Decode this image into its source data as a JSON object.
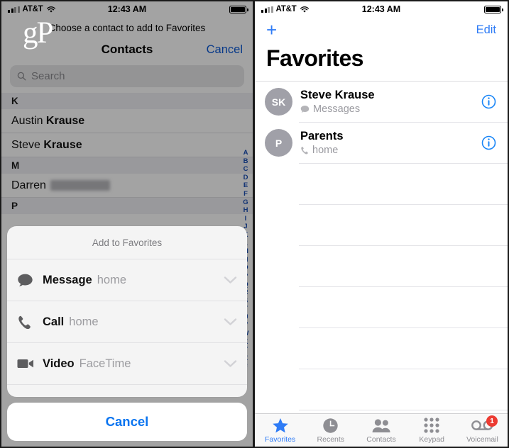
{
  "status_bar": {
    "carrier": "AT&T",
    "time": "12:43 AM",
    "signal_bars_filled": 2,
    "signal_bars_total": 4,
    "wifi": "wifi-icon",
    "battery": "battery-full-icon"
  },
  "left_screen": {
    "watermark": "gP",
    "prompt": "Choose a contact to add to Favorites",
    "navbar": {
      "title": "Contacts",
      "cancel_label": "Cancel"
    },
    "search": {
      "placeholder": "Search",
      "value": "",
      "icon": "search-icon"
    },
    "sections": [
      {
        "letter": "K",
        "contacts": [
          {
            "given": "Austin",
            "family": "Krause",
            "redacted": false
          },
          {
            "given": "Steve",
            "family": "Krause",
            "redacted": false
          }
        ]
      },
      {
        "letter": "M",
        "contacts": [
          {
            "given": "Darren",
            "family": "",
            "redacted": true
          }
        ]
      },
      {
        "letter": "P",
        "contacts": []
      }
    ],
    "alpha_index": [
      "A",
      "B",
      "C",
      "D",
      "E",
      "F",
      "G",
      "H",
      "I",
      "J",
      "K",
      "L",
      "M",
      "N",
      "O",
      "P",
      "Q",
      "R",
      "S",
      "T",
      "U",
      "V",
      "W",
      "X",
      "Y",
      "Z",
      "#"
    ],
    "action_sheet": {
      "title": "Add to Favorites",
      "options": [
        {
          "icon": "message-bubble-icon",
          "label": "Message",
          "detail": "home",
          "chevron": "chevron-down-icon"
        },
        {
          "icon": "phone-handset-icon",
          "label": "Call",
          "detail": "home",
          "chevron": "chevron-down-icon"
        },
        {
          "icon": "video-camera-icon",
          "label": "Video",
          "detail": "FaceTime",
          "chevron": "chevron-down-icon"
        }
      ],
      "cancel_label": "Cancel"
    }
  },
  "right_screen": {
    "navbar": {
      "add_label": "+",
      "edit_label": "Edit"
    },
    "title": "Favorites",
    "favorites": [
      {
        "initials": "SK",
        "name": "Steve Krause",
        "type_icon": "message-bubble-icon",
        "type_label": "Messages",
        "info_icon": "info-circle-icon"
      },
      {
        "initials": "P",
        "name": "Parents",
        "type_icon": "phone-handset-icon",
        "type_label": "home",
        "info_icon": "info-circle-icon"
      }
    ],
    "empty_rows": 7,
    "tabs": [
      {
        "icon": "star-icon",
        "label": "Favorites",
        "active": true,
        "badge": ""
      },
      {
        "icon": "clock-icon",
        "label": "Recents",
        "active": false,
        "badge": ""
      },
      {
        "icon": "contacts-icon",
        "label": "Contacts",
        "active": false,
        "badge": ""
      },
      {
        "icon": "keypad-icon",
        "label": "Keypad",
        "active": false,
        "badge": ""
      },
      {
        "icon": "voicemail-icon",
        "label": "Voicemail",
        "active": false,
        "badge": "1"
      }
    ]
  },
  "colors": {
    "accent_blue": "#2f7cf6",
    "link_blue": "#0b59d6",
    "badge_red": "#ec3b32",
    "index_blue": "#1a4fb4",
    "avatar_gray": "#a0a0a8",
    "tab_inactive": "#8e8e93"
  }
}
